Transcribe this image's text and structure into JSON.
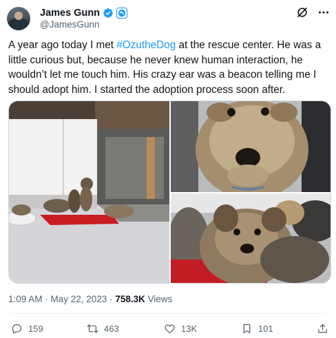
{
  "author": {
    "display_name": "James Gunn",
    "handle": "@JamesGunn",
    "verified": true
  },
  "header_icons": [
    "grok-icon",
    "more-icon"
  ],
  "tweet": {
    "text_before": "A year ago today I met ",
    "hashtag": "#OzutheDog",
    "text_after": " at the rescue center. He was a little curious but, because he never knew human interaction, he wouldn’t let me touch him. His crazy ear was a beacon telling me I should adopt him. I started the adoption process soon after."
  },
  "meta": {
    "time": "1:09 AM",
    "sep1": " · ",
    "date": "May 22, 2023",
    "sep2": " · ",
    "views_count": "758.3K",
    "views_label": " Views"
  },
  "actions": {
    "reply_count": "159",
    "repost_count": "463",
    "like_count": "13K",
    "bookmark_count": "101"
  },
  "colors": {
    "accent": "#1d9bf0",
    "text": "#0f1419",
    "secondary": "#536471"
  }
}
